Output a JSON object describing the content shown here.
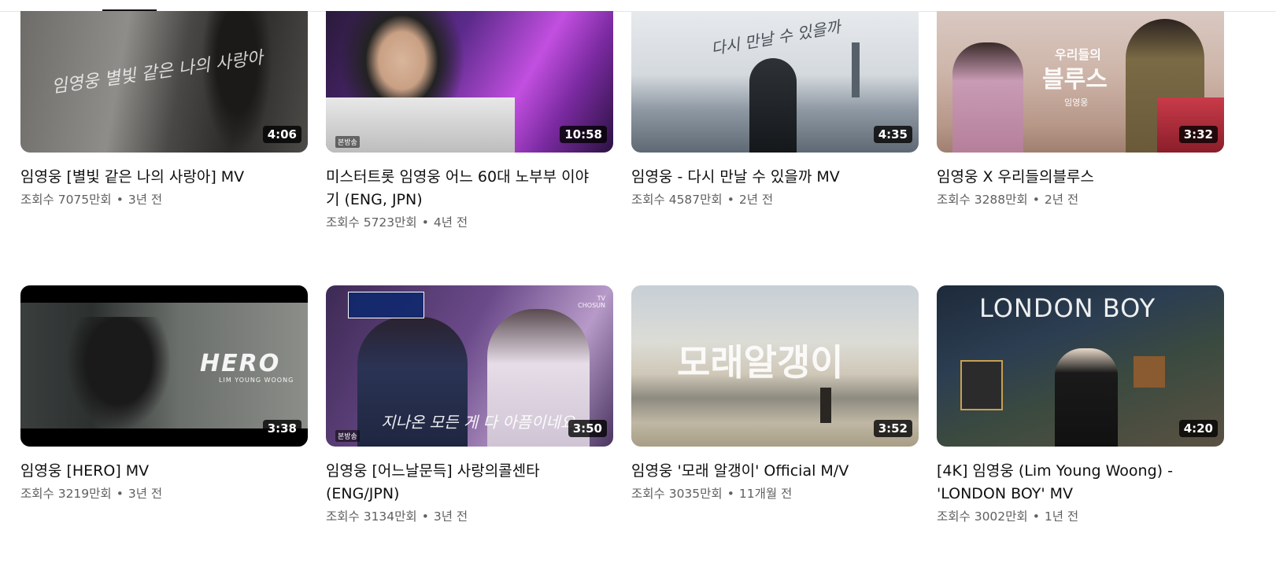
{
  "videos": [
    {
      "title": "임영웅 [별빛 같은 나의 사랑아] MV",
      "views": "조회수 7075만회",
      "age": "3년 전",
      "duration": "4:06",
      "thumb_text": "임영웅 별빛 같은 나의 사랑아"
    },
    {
      "title": "미스터트롯 임영웅 어느 60대 노부부 이야기 (ENG, JPN)",
      "views": "조회수 5723만회",
      "age": "4년 전",
      "duration": "10:58",
      "thumb_badge": "본방송"
    },
    {
      "title": "임영웅 - 다시 만날 수 있을까 MV",
      "views": "조회수 4587만회",
      "age": "2년 전",
      "duration": "4:35",
      "thumb_text": "다시 만날 수 있을까"
    },
    {
      "title": "임영웅 X 우리들의블루스",
      "views": "조회수 3288만회",
      "age": "2년 전",
      "duration": "3:32",
      "thumb_text": "우리들의",
      "thumb_text2": "블루스",
      "thumb_text3": "임영웅"
    },
    {
      "title": "임영웅 [HERO] MV",
      "views": "조회수 3219만회",
      "age": "3년 전",
      "duration": "3:38",
      "thumb_text": "HERO",
      "thumb_text2": "LIM YOUNG WOONG"
    },
    {
      "title": "임영웅 [어느날문득] 사랑의콜센타 (ENG/JPN)",
      "views": "조회수 3134만회",
      "age": "3년 전",
      "duration": "3:50",
      "thumb_text": "지나온 모든 게 다 아픔이네요",
      "thumb_badge": "본방송",
      "thumb_logo": "TV CHOSUN"
    },
    {
      "title": "임영웅 '모래 알갱이' Official M/V",
      "views": "조회수 3035만회",
      "age": "11개월 전",
      "duration": "3:52",
      "thumb_text": "모래알갱이"
    },
    {
      "title": "[4K] 임영웅 (Lim Young Woong) - 'LONDON BOY' MV",
      "views": "조회수 3002만회",
      "age": "1년 전",
      "duration": "4:20",
      "thumb_text": "LONDON BOY"
    }
  ],
  "colors": {
    "meta_text": "#606060",
    "title_text": "#0f0f0f",
    "duration_bg": "#000000"
  }
}
